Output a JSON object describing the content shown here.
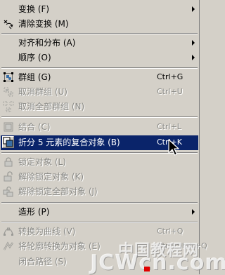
{
  "menu": {
    "items": [
      {
        "label": "变换 (F)",
        "submenu": true
      },
      {
        "label": "清除变换 (M)"
      },
      {
        "label": "对齐和分布 (A)",
        "submenu": true
      },
      {
        "label": "顺序 (O)",
        "submenu": true
      },
      {
        "label": "群组 (G)",
        "shortcut": "Ctrl+G"
      },
      {
        "label": "取消群组 (U)",
        "shortcut": "Ctrl+U",
        "disabled": true
      },
      {
        "label": "取消全部群组 (N)",
        "disabled": true
      },
      {
        "label": "结合 (C)",
        "shortcut": "Ctrl+L",
        "disabled": true
      },
      {
        "label": "折分 5 元素的复合对象 (B)",
        "shortcut": "Ctrl+K",
        "selected": true
      },
      {
        "label": "锁定对象 (L)",
        "disabled": true
      },
      {
        "label": "解除锁定对象 (K)",
        "disabled": true
      },
      {
        "label": "解除锁定全部对象 (J)",
        "disabled": true
      },
      {
        "label": "造形 (P)",
        "submenu": true
      },
      {
        "label": "转换为曲线 (V)",
        "shortcut": "Ctrl+Q",
        "disabled": true
      },
      {
        "label": "将轮廓转换为对象 (E)",
        "shortcut": "Ctrl+Shift+Q",
        "disabled": true
      },
      {
        "label": "闭合路径 (S)",
        "disabled": true
      }
    ]
  },
  "watermark": {
    "line1": "中国教程网",
    "line2": "JCWcn.com"
  },
  "colors": {
    "menu_bg": "#d4d0c8",
    "highlight": "#0a246a",
    "disabled_text": "#8a8a86"
  }
}
